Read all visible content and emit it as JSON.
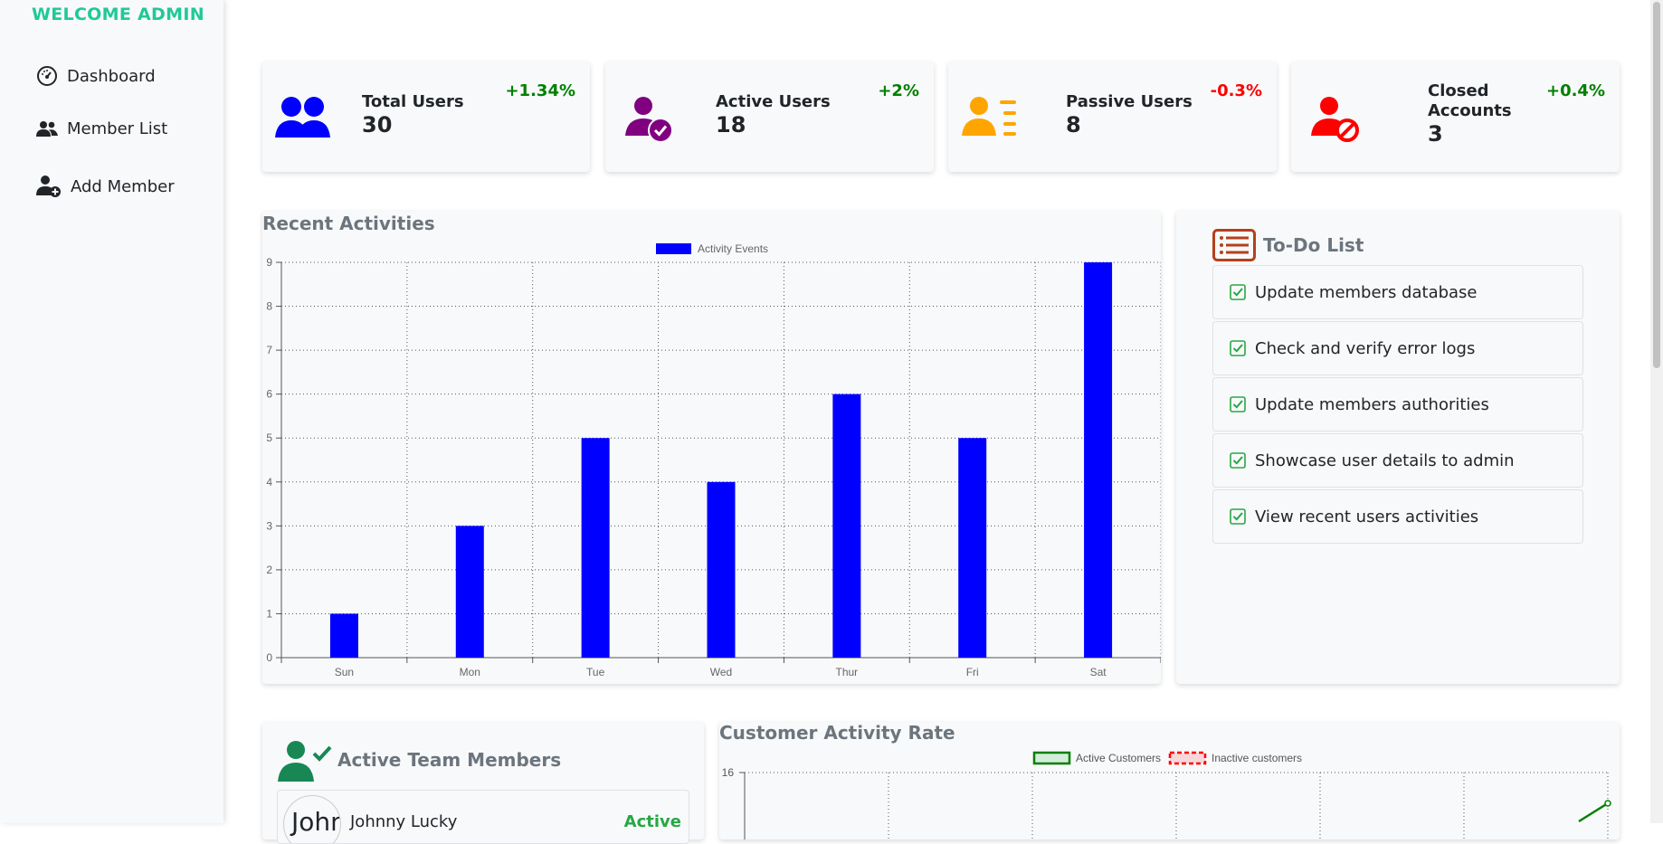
{
  "sidebar": {
    "welcome": "WELCOME ADMIN",
    "items": [
      {
        "label": "Dashboard",
        "icon": "gauge-icon"
      },
      {
        "label": "Member List",
        "icon": "users-icon"
      },
      {
        "label": "Add Member",
        "icon": "user-plus-icon"
      }
    ]
  },
  "stats": [
    {
      "title": "Total Users",
      "value": "30",
      "change": "+1.34%",
      "change_color": "#008000",
      "icon": "users-icon",
      "icon_color": "#0000ff"
    },
    {
      "title": "Active Users",
      "value": "18",
      "change": "+2%",
      "change_color": "#008000",
      "icon": "user-check-icon",
      "icon_color": "#800080"
    },
    {
      "title": "Passive Users",
      "value": "8",
      "change": "-0.3%",
      "change_color": "#ff0000",
      "icon": "user-list-icon",
      "icon_color": "#ffa500"
    },
    {
      "title_line1": "Closed",
      "title_line2": "Accounts",
      "value": "3",
      "change": "+0.4%",
      "change_color": "#008000",
      "icon": "user-blocked-icon",
      "icon_color": "#ff0000"
    }
  ],
  "recent_activities": {
    "title": "Recent Activities"
  },
  "chart_data": [
    {
      "type": "bar",
      "title": "Recent Activities",
      "categories": [
        "Sun",
        "Mon",
        "Tue",
        "Wed",
        "Thur",
        "Fri",
        "Sat"
      ],
      "series": [
        {
          "name": "Activity Events",
          "values": [
            1,
            3,
            5,
            4,
            6,
            5,
            9
          ],
          "color": "#0000ff"
        }
      ],
      "ylim": [
        0,
        9
      ],
      "yticks": [
        "0",
        "1",
        "2",
        "3",
        "4",
        "5",
        "6",
        "7",
        "8",
        "9"
      ],
      "grid": true,
      "legend": "top-center"
    },
    {
      "type": "line",
      "title": "Customer Activity Rate",
      "series": [
        {
          "name": "Active Customers",
          "color": "#008000"
        },
        {
          "name": "Inactive customers",
          "color": "#ff0000"
        }
      ],
      "yticks": [
        "16"
      ],
      "grid": true,
      "legend": "top-center"
    }
  ],
  "todo": {
    "title": "To-Do List",
    "items": [
      "Update members database",
      "Check and verify error logs",
      "Update members authorities",
      "Showcase user details to admin",
      "View recent users activities"
    ]
  },
  "team": {
    "title": "Active Team Members",
    "members": [
      {
        "name": "Johnny Lucky",
        "avatar_alt": "Johnr",
        "status": "Active",
        "status_color": "#28a745"
      }
    ]
  },
  "customer_rate": {
    "title": "Customer Activity Rate"
  }
}
